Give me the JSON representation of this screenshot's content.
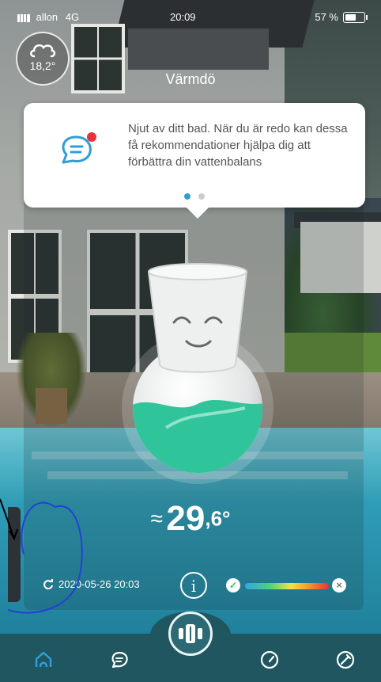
{
  "status_bar": {
    "carrier": "allon",
    "network": "4G",
    "time": "20:09",
    "battery": "57 %"
  },
  "weather": {
    "icon": "cloud-icon",
    "temperature": "18,2°"
  },
  "location": "Värmdö",
  "tooltip": {
    "icon": "chat-notification-icon",
    "message": "Njut av ditt bad. När du är redo kan dessa få rekommendationer hjälpa dig att förbättra din vattenbalans",
    "page_count": 2,
    "active_page": 1
  },
  "water": {
    "approx_symbol": "≈",
    "temp_whole": "29",
    "temp_decimal": ",6°"
  },
  "info_row": {
    "last_sync": "2020-05-26 20:03",
    "info_label": "i"
  },
  "colors": {
    "accent": "#2f9ed8",
    "tabbar": "#1f5660",
    "water_fill": "#2fc49a"
  },
  "tabs": [
    {
      "name": "home",
      "icon": "pool-home-icon"
    },
    {
      "name": "messages",
      "icon": "chat-icon"
    },
    {
      "name": "device",
      "icon": "device-icon"
    },
    {
      "name": "dashboard",
      "icon": "gauge-icon"
    },
    {
      "name": "settings",
      "icon": "tools-icon"
    }
  ]
}
